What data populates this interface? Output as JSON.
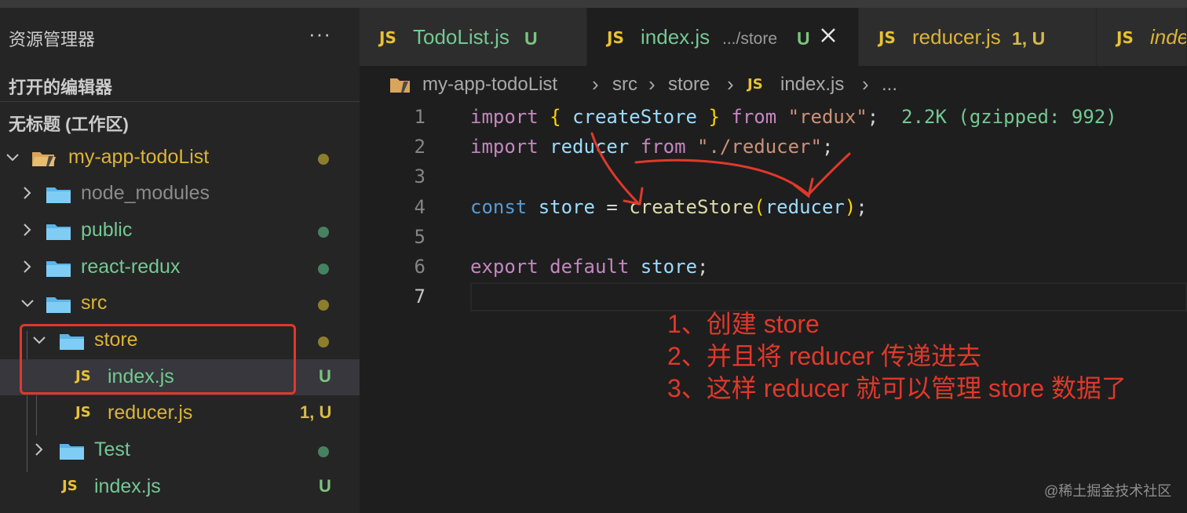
{
  "sidebar": {
    "title": "资源管理器",
    "more": "···",
    "open_editors": "打开的编辑器",
    "workspace": "无标题 (工作区)",
    "tree": [
      {
        "label": "my-app-todoList",
        "kind": "root",
        "expanded": true,
        "dot": "yellow"
      },
      {
        "label": "node_modules",
        "kind": "folder",
        "expanded": false
      },
      {
        "label": "public",
        "kind": "folder",
        "expanded": false,
        "dot": "green"
      },
      {
        "label": "react-redux",
        "kind": "folder",
        "expanded": false,
        "dot": "green"
      },
      {
        "label": "src",
        "kind": "folder",
        "expanded": true,
        "dot": "yellow"
      },
      {
        "label": "store",
        "kind": "folder",
        "expanded": true,
        "dot": "yellow"
      },
      {
        "label": "index.js",
        "kind": "file",
        "badge": "U",
        "selected": true
      },
      {
        "label": "reducer.js",
        "kind": "file",
        "badge": "1, U"
      },
      {
        "label": "Test",
        "kind": "folder",
        "expanded": false,
        "dot": "green"
      },
      {
        "label": "index.js",
        "kind": "file",
        "badge": "U"
      }
    ]
  },
  "tabs": [
    {
      "icon": "JS",
      "label": "TodoList.js",
      "status": "U"
    },
    {
      "icon": "JS",
      "label": "index.js",
      "desc": ".../store",
      "status": "U",
      "active": true
    },
    {
      "icon": "JS",
      "label": "reducer.js",
      "status": "1, U"
    },
    {
      "icon": "JS",
      "label": "inde"
    }
  ],
  "breadcrumb": {
    "items": [
      "my-app-todoList",
      "src",
      "store",
      "index.js",
      "..."
    ],
    "file_icon": "JS"
  },
  "code": {
    "line_numbers": [
      "1",
      "2",
      "3",
      "4",
      "5",
      "6",
      "7"
    ],
    "import_size_hint": "2.2K (gzipped: 992)"
  },
  "annotations": [
    "1、创建 store",
    "2、并且将 reducer 传递进去",
    "3、这样 reducer 就可以管理 store 数据了"
  ],
  "watermark": "@稀土掘金技术社区",
  "colors": {
    "annotation": "#e0382b",
    "js_icon": "#e8c232",
    "untracked": "#73c991",
    "modified": "#dcb436"
  },
  "icons": [
    "folder-icon",
    "js-file-icon",
    "chevron-right-icon",
    "chevron-down-icon",
    "close-icon",
    "more-icon"
  ]
}
